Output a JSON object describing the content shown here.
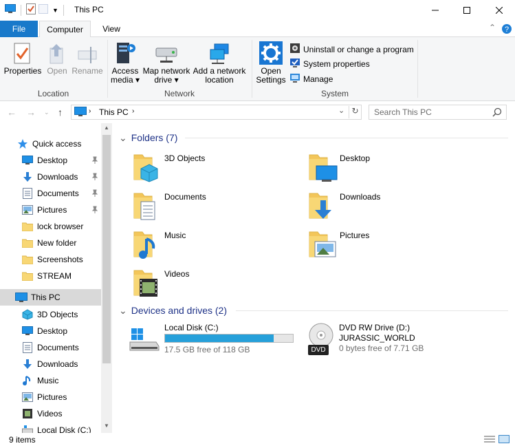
{
  "window": {
    "title": "This PC"
  },
  "ribbon": {
    "tabs": {
      "file": "File",
      "computer": "Computer",
      "view": "View"
    },
    "location": {
      "group_label": "Location",
      "properties": "Properties",
      "open": "Open",
      "rename": "Rename"
    },
    "network": {
      "group_label": "Network",
      "access_media_1": "Access",
      "access_media_2": "media ▾",
      "map_drive_1": "Map network",
      "map_drive_2": "drive ▾",
      "add_location_1": "Add a network",
      "add_location_2": "location"
    },
    "system": {
      "group_label": "System",
      "open_settings_1": "Open",
      "open_settings_2": "Settings",
      "uninstall": "Uninstall or change a program",
      "system_properties": "System properties",
      "manage": "Manage"
    }
  },
  "address": {
    "crumb": "This PC",
    "search_placeholder": "Search This PC"
  },
  "nav_pane": {
    "quick_access": "Quick access",
    "quick_items": [
      {
        "label": "Desktop",
        "icon": "desktop-icon",
        "pinned": true
      },
      {
        "label": "Downloads",
        "icon": "download-arrow-icon",
        "pinned": true
      },
      {
        "label": "Documents",
        "icon": "documents-icon",
        "pinned": true
      },
      {
        "label": "Pictures",
        "icon": "pictures-icon",
        "pinned": true
      },
      {
        "label": "lock browser",
        "icon": "folder-icon",
        "pinned": false
      },
      {
        "label": "New folder",
        "icon": "folder-icon",
        "pinned": false
      },
      {
        "label": "Screenshots",
        "icon": "folder-icon",
        "pinned": false
      },
      {
        "label": "STREAM",
        "icon": "folder-icon",
        "pinned": false
      }
    ],
    "this_pc": "This PC",
    "pc_items": [
      {
        "label": "3D Objects",
        "icon": "3d-objects-icon"
      },
      {
        "label": "Desktop",
        "icon": "desktop-icon"
      },
      {
        "label": "Documents",
        "icon": "documents-icon"
      },
      {
        "label": "Downloads",
        "icon": "download-arrow-icon"
      },
      {
        "label": "Music",
        "icon": "music-note-icon"
      },
      {
        "label": "Pictures",
        "icon": "pictures-icon"
      },
      {
        "label": "Videos",
        "icon": "videos-icon"
      },
      {
        "label": "Local Disk (C:)",
        "icon": "drive-icon"
      }
    ]
  },
  "content": {
    "folders_header": "Folders (7)",
    "folders": [
      {
        "label": "3D Objects",
        "icon": "3d-objects-folder-icon"
      },
      {
        "label": "Desktop",
        "icon": "desktop-folder-icon"
      },
      {
        "label": "Documents",
        "icon": "documents-folder-icon"
      },
      {
        "label": "Downloads",
        "icon": "downloads-folder-icon"
      },
      {
        "label": "Music",
        "icon": "music-folder-icon"
      },
      {
        "label": "Pictures",
        "icon": "pictures-folder-icon"
      },
      {
        "label": "Videos",
        "icon": "videos-folder-icon"
      }
    ],
    "drives_header": "Devices and drives (2)",
    "drives": [
      {
        "name": "Local Disk (C:)",
        "free": "17.5 GB free of 118 GB",
        "used_fraction": 0.852
      },
      {
        "name": "DVD RW Drive (D:)",
        "label": "JURASSIC_WORLD",
        "free": "0 bytes free of 7.71 GB",
        "badge": "DVD"
      }
    ]
  },
  "status": {
    "count": "9 items"
  },
  "colors": {
    "accent": "#1979ca",
    "header_blue": "#1e3287",
    "bar_fill": "#26a0da",
    "folder_yellow": "#f8d775"
  }
}
